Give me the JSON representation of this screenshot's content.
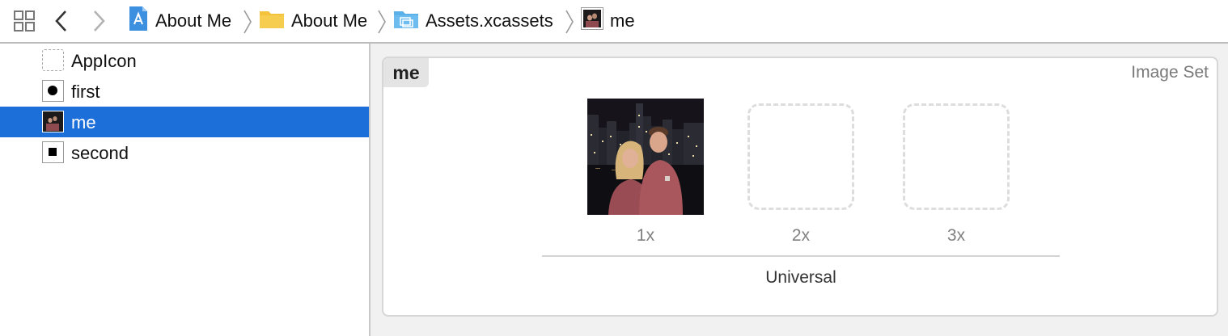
{
  "jumpbar": {
    "breadcrumb": [
      {
        "label": "About Me",
        "icon": "xcode-project-icon"
      },
      {
        "label": "About Me",
        "icon": "folder-icon"
      },
      {
        "label": "Assets.xcassets",
        "icon": "asset-catalog-icon"
      },
      {
        "label": "me",
        "icon": "image-thumbnail-icon"
      }
    ]
  },
  "navigator": {
    "items": [
      {
        "label": "AppIcon",
        "icon": "app-icon-placeholder"
      },
      {
        "label": "first",
        "icon": "circle-glyph-icon"
      },
      {
        "label": "me",
        "icon": "photo-thumbnail"
      },
      {
        "label": "second",
        "icon": "square-glyph-icon"
      }
    ],
    "selected_index": 2
  },
  "editor": {
    "set_name": "me",
    "set_type": "Image Set",
    "slots": [
      {
        "label": "1x",
        "filled": true
      },
      {
        "label": "2x",
        "filled": false
      },
      {
        "label": "3x",
        "filled": false
      }
    ],
    "group_label": "Universal"
  },
  "colors": {
    "selection": "#1c6ed8",
    "folder_yellow": "#f5c33b",
    "catalog_blue": "#5ab1ea"
  }
}
